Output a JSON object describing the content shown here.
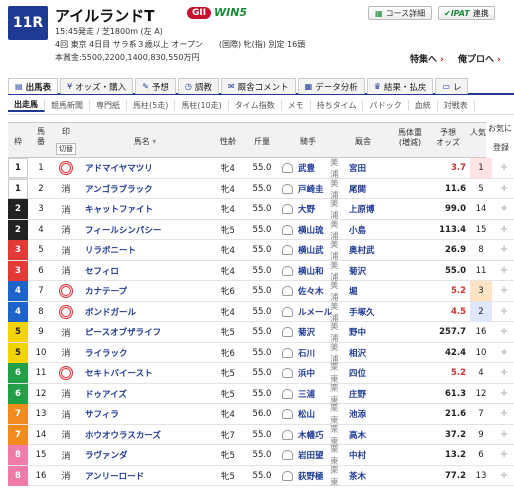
{
  "race": {
    "number": "11R",
    "name": "アイルランドT",
    "grade": "GII",
    "win5": "WIN5",
    "info1": "15:45発走 / 芝1800m (左 A)",
    "info2": "4回 東京 4日目 サラ系３歳以上 オープン　　(国際) 牝(指) 別定 16頭",
    "info3": "本賞金:5500,2200,1400,830,550万円"
  },
  "buttons": {
    "course": "コース詳細",
    "ipat_logo": "IPAT",
    "ipat": "連携"
  },
  "links": {
    "feature": "特集へ",
    "pro": "俺プロへ"
  },
  "tabs": [
    {
      "label": "出馬表",
      "icon": "grid-icon"
    },
    {
      "label": "オッズ・購入",
      "icon": "yen-icon"
    },
    {
      "label": "予想",
      "icon": "pencil-icon"
    },
    {
      "label": "調教",
      "icon": "stopwatch-icon"
    },
    {
      "label": "厩舎コメント",
      "icon": "comment-icon"
    },
    {
      "label": "データ分析",
      "icon": "chart-icon"
    },
    {
      "label": "結果・払戻",
      "icon": "trophy-icon"
    },
    {
      "label": "レ",
      "icon": "doc-icon"
    }
  ],
  "subtabs": [
    "出走馬",
    "競馬新聞",
    "専門紙",
    "馬柱(5走)",
    "馬柱(10走)",
    "タイム指数",
    "メモ",
    "持ちタイム",
    "パドック",
    "血統",
    "対戦表"
  ],
  "headers": {
    "waku": "枠",
    "uma": "馬番",
    "mark": "印",
    "mark_sub": "切替",
    "name": "馬名",
    "sex": "性齢",
    "kin": "斤量",
    "jockey": "騎手",
    "trainer": "厩舎",
    "weight": "馬体重",
    "weight_sub": "(増減)",
    "odds": "予想",
    "odds_sub": "オッズ",
    "pop": "人気",
    "fav": "お気に",
    "fav_sub": "登録"
  },
  "entries": [
    {
      "waku": "1",
      "uma": "1",
      "mark": "circle",
      "name": "アドマイヤマツリ",
      "sex": "牝4",
      "kin": "55.0",
      "jockey": "武豊",
      "belong": "美浦",
      "trainer": "宮田",
      "odds": "3.7",
      "pop": "1"
    },
    {
      "waku": "1",
      "uma": "2",
      "mark": "消",
      "name": "アンゴラブラック",
      "sex": "牝4",
      "kin": "55.0",
      "jockey": "戸崎圭",
      "belong": "美浦",
      "trainer": "尾関",
      "odds": "11.6",
      "pop": "5"
    },
    {
      "waku": "2",
      "uma": "3",
      "mark": "消",
      "name": "キャットファイト",
      "sex": "牝4",
      "kin": "55.0",
      "jockey": "大野",
      "belong": "美浦",
      "trainer": "上原博",
      "odds": "99.0",
      "pop": "14"
    },
    {
      "waku": "2",
      "uma": "4",
      "mark": "消",
      "name": "フィールシンパシー",
      "sex": "牝5",
      "kin": "55.0",
      "jockey": "横山琉",
      "belong": "美浦",
      "trainer": "小島",
      "odds": "113.4",
      "pop": "15"
    },
    {
      "waku": "3",
      "uma": "5",
      "mark": "消",
      "name": "リラボニート",
      "sex": "牝4",
      "kin": "55.0",
      "jockey": "横山武",
      "belong": "美浦",
      "trainer": "奥村武",
      "odds": "26.9",
      "pop": "8"
    },
    {
      "waku": "3",
      "uma": "6",
      "mark": "消",
      "name": "セフィロ",
      "sex": "牝4",
      "kin": "55.0",
      "jockey": "横山和",
      "belong": "美浦",
      "trainer": "菊沢",
      "odds": "55.0",
      "pop": "11"
    },
    {
      "waku": "4",
      "uma": "7",
      "mark": "circle",
      "name": "カナテープ",
      "sex": "牝6",
      "kin": "55.0",
      "jockey": "佐々木",
      "belong": "美浦",
      "trainer": "堀",
      "odds": "5.2",
      "pop": "3"
    },
    {
      "waku": "4",
      "uma": "8",
      "mark": "circle",
      "name": "ボンドガール",
      "sex": "牝4",
      "kin": "55.0",
      "jockey": "ルメール",
      "belong": "美浦",
      "trainer": "手塚久",
      "odds": "4.5",
      "pop": "2"
    },
    {
      "waku": "5",
      "uma": "9",
      "mark": "消",
      "name": "ピースオブザライフ",
      "sex": "牝5",
      "kin": "55.0",
      "jockey": "菊沢",
      "belong": "美浦",
      "trainer": "野中",
      "odds": "257.7",
      "pop": "16"
    },
    {
      "waku": "5",
      "uma": "10",
      "mark": "消",
      "name": "ライラック",
      "sex": "牝6",
      "kin": "55.0",
      "jockey": "石川",
      "belong": "美浦",
      "trainer": "相沢",
      "odds": "42.4",
      "pop": "10"
    },
    {
      "waku": "6",
      "uma": "11",
      "mark": "circle",
      "name": "セキトバイースト",
      "sex": "牝5",
      "kin": "55.0",
      "jockey": "浜中",
      "belong": "栗東",
      "trainer": "四位",
      "odds": "5.2",
      "pop": "4"
    },
    {
      "waku": "6",
      "uma": "12",
      "mark": "消",
      "name": "ドゥアイズ",
      "sex": "牝5",
      "kin": "55.0",
      "jockey": "三浦",
      "belong": "栗東",
      "trainer": "庄野",
      "odds": "61.3",
      "pop": "12"
    },
    {
      "waku": "7",
      "uma": "13",
      "mark": "消",
      "name": "サフィラ",
      "sex": "牝4",
      "kin": "56.0",
      "jockey": "松山",
      "belong": "栗東",
      "trainer": "池添",
      "odds": "21.6",
      "pop": "7"
    },
    {
      "waku": "7",
      "uma": "14",
      "mark": "消",
      "name": "ホウオウラスカーズ",
      "sex": "牝7",
      "kin": "55.0",
      "jockey": "木幡巧",
      "belong": "栗東",
      "trainer": "高木",
      "odds": "37.2",
      "pop": "9"
    },
    {
      "waku": "8",
      "uma": "15",
      "mark": "消",
      "name": "ラヴァンダ",
      "sex": "牝5",
      "kin": "55.0",
      "jockey": "岩田望",
      "belong": "栗東",
      "trainer": "中村",
      "odds": "13.2",
      "pop": "6"
    },
    {
      "waku": "8",
      "uma": "16",
      "mark": "消",
      "name": "アンリーロード",
      "sex": "牝5",
      "kin": "55.0",
      "jockey": "荻野極",
      "belong": "栗東",
      "trainer": "茶木",
      "odds": "77.2",
      "pop": "13"
    }
  ],
  "colors": {
    "waku": {
      "1": "#ffffff",
      "2": "#222222",
      "3": "#e53935",
      "4": "#1e63c7",
      "5": "#f4d400",
      "6": "#21a048",
      "7": "#f08c1c",
      "8": "#f07aa8"
    },
    "waku_text": {
      "1": "#222222",
      "2": "#ffffff",
      "3": "#ffffff",
      "4": "#ffffff",
      "5": "#222222",
      "6": "#ffffff",
      "7": "#ffffff",
      "8": "#ffffff"
    },
    "pop1": "#fde3e3",
    "pop2": "#dfe8fb",
    "pop3": "#fbe3c4",
    "odds_low": "#d32f2f"
  }
}
